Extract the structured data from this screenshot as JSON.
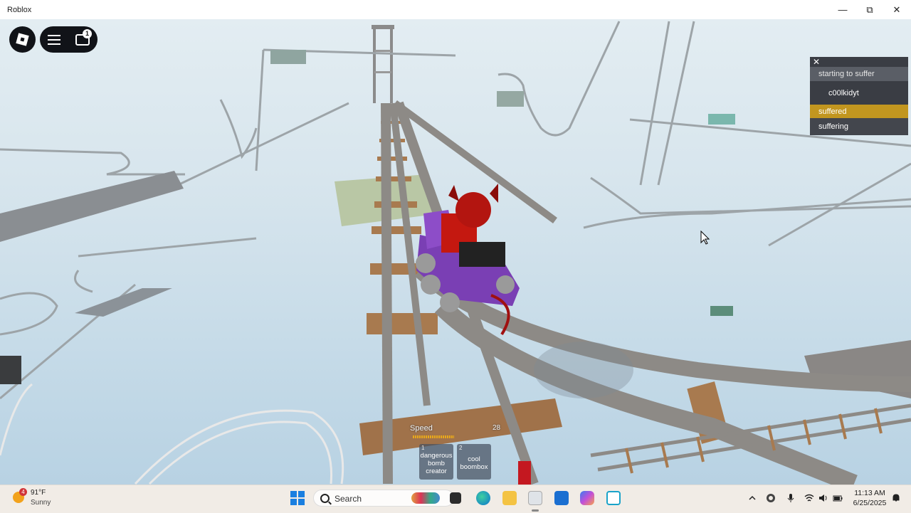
{
  "window": {
    "title": "Roblox",
    "minimize_glyph": "—",
    "maximize_glyph": "⧉",
    "close_glyph": "✕"
  },
  "hud": {
    "chat_badge_count": "1",
    "icons": [
      "roblox-logo-icon",
      "hamburger-menu-icon",
      "chat-icon"
    ]
  },
  "playerlist": {
    "close_glyph": "✕",
    "rows": [
      {
        "label": "starting to suffer",
        "color": "#5a5e66",
        "text_color": "#e6e6e6"
      },
      {
        "label": "c00lkidyt",
        "color": "#3a3d44",
        "text_color": "#ffffff"
      },
      {
        "label": "suffered",
        "color": "#c2961f",
        "text_color": "#ffffff"
      },
      {
        "label": "suffering",
        "color": "#43464d",
        "text_color": "#ffffff"
      }
    ]
  },
  "hotbar": {
    "speed_label": "Speed",
    "speed_value": "28",
    "slots": [
      {
        "number": "1",
        "name": "dangerous bomb creator"
      },
      {
        "number": "2",
        "name": "cool boombox"
      }
    ]
  },
  "taskbar": {
    "weather_temp": "91°F",
    "weather_condition": "Sunny",
    "weather_badge": "4",
    "search_label": "Search",
    "clock_time": "11:13 AM",
    "clock_date": "6/25/2025",
    "apps": [
      "widgets-icon",
      "task-view-icon",
      "edge-icon",
      "file-explorer-icon",
      "roblox-app-icon",
      "store-icon",
      "copilot-icon",
      "snipping-tool-icon"
    ],
    "tray": [
      "chevron-up-icon",
      "onedrive-icon",
      "microphone-icon",
      "wifi-icon",
      "speaker-icon",
      "battery-icon",
      "notification-icon"
    ]
  },
  "colors": {
    "track_gray": "#8d8a86",
    "plank_brown": "#a87a4f",
    "cart_purple": "#7a3fb4",
    "avatar_red": "#c41810",
    "sky": "#d3e3ec"
  }
}
